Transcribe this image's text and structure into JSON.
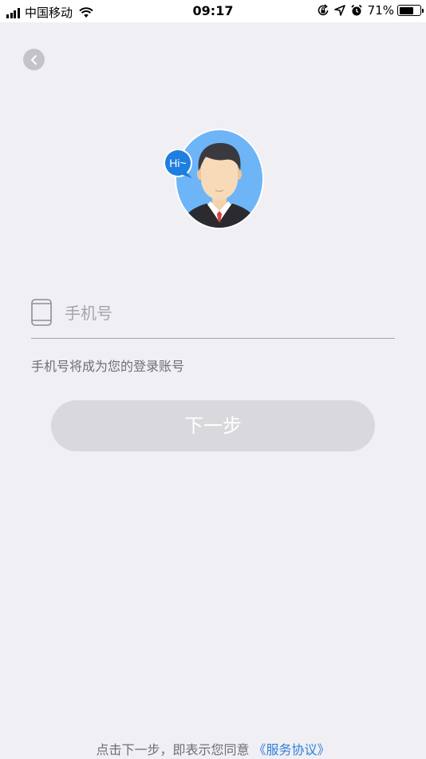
{
  "status_bar": {
    "carrier": "中国移动",
    "time": "09:17",
    "battery_percent": "71%",
    "battery_level": 0.71,
    "icons": [
      "signal-icon",
      "wifi-icon",
      "orientation-lock-icon",
      "location-icon",
      "alarm-icon",
      "battery-icon"
    ]
  },
  "nav": {
    "back_icon": "chevron-left-icon"
  },
  "avatar": {
    "bubble_text": "Hi~",
    "bubble_color": "#1f7fe0",
    "background_color": "#6eb5f7"
  },
  "form": {
    "phone_icon": "mobile-phone-icon",
    "phone_placeholder": "手机号",
    "phone_value": "",
    "hint": "手机号将成为您的登录账号",
    "next_label": "下一步"
  },
  "footer": {
    "prefix": "点击下一步，即表示您同意",
    "agreement_link": "《服务协议》",
    "link_color": "#2f80d8"
  }
}
